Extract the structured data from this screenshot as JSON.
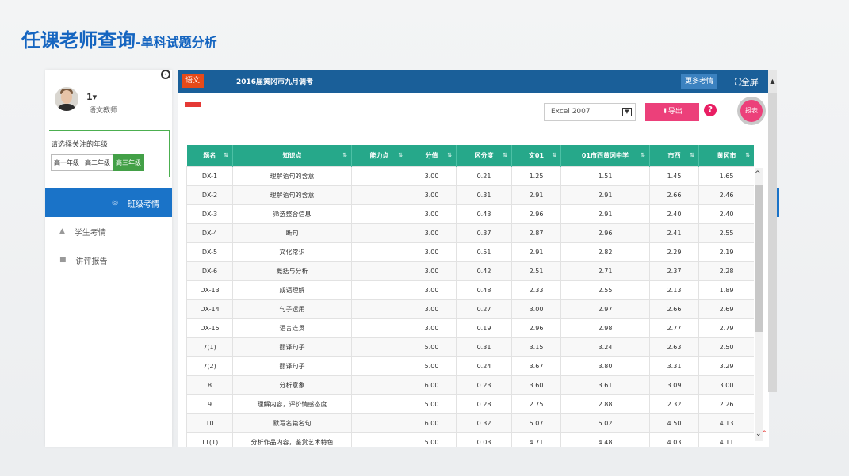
{
  "page": {
    "title_main": "任课老师查询",
    "title_sub": "-单科试题分析"
  },
  "sidebar": {
    "user_name": "1",
    "user_role": "语文教师",
    "grade_label": "请选择关注的年级",
    "grades": [
      "高一年级",
      "高二年级",
      "高三年级"
    ],
    "active_grade": "高三年级",
    "nav": [
      {
        "label": "班级考情",
        "icon": "users-icon",
        "active": true
      },
      {
        "label": "学生考情",
        "icon": "user-icon",
        "active": false
      },
      {
        "label": "讲评报告",
        "icon": "report-icon",
        "active": false
      }
    ]
  },
  "topbar": {
    "subject": "语文",
    "exam_title": "2016届黄冈市九月调考",
    "more_label": "更多考情",
    "fullscreen_label": "全屏"
  },
  "toolbar": {
    "export_format": "Excel 2007",
    "export_label": "导出",
    "help_label": "?",
    "report_label": "报表"
  },
  "colors": {
    "accent_blue": "#1a5f99",
    "header_green": "#26a88a",
    "export_pink": "#ec407a",
    "active_nav": "#1a73c8"
  },
  "table": {
    "headers": [
      "题名",
      "知识点",
      "能力点",
      "分值",
      "区分度",
      "文01",
      "01市西黄冈中学",
      "市西",
      "黄冈市"
    ],
    "rows": [
      [
        "DX-1",
        "理解语句的含意",
        "",
        "3.00",
        "0.21",
        "1.25",
        "1.51",
        "1.45",
        "1.65"
      ],
      [
        "DX-2",
        "理解语句的含意",
        "",
        "3.00",
        "0.31",
        "2.91",
        "2.91",
        "2.66",
        "2.46"
      ],
      [
        "DX-3",
        "筛选整合信息",
        "",
        "3.00",
        "0.43",
        "2.96",
        "2.91",
        "2.40",
        "2.40"
      ],
      [
        "DX-4",
        "断句",
        "",
        "3.00",
        "0.37",
        "2.87",
        "2.96",
        "2.41",
        "2.55"
      ],
      [
        "DX-5",
        "文化常识",
        "",
        "3.00",
        "0.51",
        "2.91",
        "2.82",
        "2.29",
        "2.19"
      ],
      [
        "DX-6",
        "概括与分析",
        "",
        "3.00",
        "0.42",
        "2.51",
        "2.71",
        "2.37",
        "2.28"
      ],
      [
        "DX-13",
        "成语理解",
        "",
        "3.00",
        "0.48",
        "2.33",
        "2.55",
        "2.13",
        "1.89"
      ],
      [
        "DX-14",
        "句子运用",
        "",
        "3.00",
        "0.27",
        "3.00",
        "2.97",
        "2.66",
        "2.69"
      ],
      [
        "DX-15",
        "语言连贯",
        "",
        "3.00",
        "0.19",
        "2.96",
        "2.98",
        "2.77",
        "2.79"
      ],
      [
        "7(1)",
        "翻译句子",
        "",
        "5.00",
        "0.31",
        "3.15",
        "3.24",
        "2.63",
        "2.50"
      ],
      [
        "7(2)",
        "翻译句子",
        "",
        "5.00",
        "0.24",
        "3.67",
        "3.80",
        "3.31",
        "3.29"
      ],
      [
        "8",
        "分析意象",
        "",
        "6.00",
        "0.23",
        "3.60",
        "3.61",
        "3.09",
        "3.00"
      ],
      [
        "9",
        "理解内容，评价情感态度",
        "",
        "5.00",
        "0.28",
        "2.75",
        "2.88",
        "2.32",
        "2.26"
      ],
      [
        "10",
        "默写名篇名句",
        "",
        "6.00",
        "0.32",
        "5.07",
        "5.02",
        "4.50",
        "4.13"
      ],
      [
        "11(1)",
        "分析作品内容，鉴赏艺术特色",
        "",
        "5.00",
        "0.03",
        "4.71",
        "4.48",
        "4.03",
        "4.11"
      ]
    ]
  }
}
